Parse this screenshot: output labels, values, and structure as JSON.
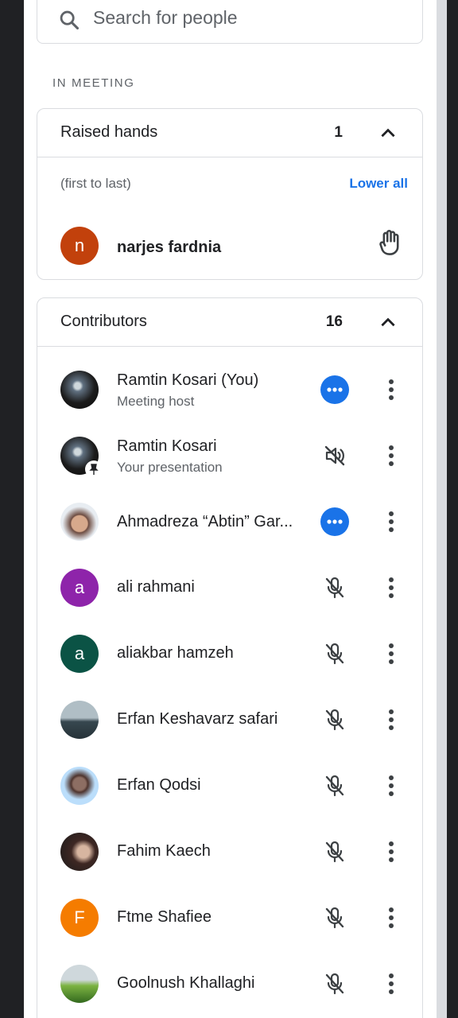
{
  "search": {
    "placeholder": "Search for people"
  },
  "in_meeting_label": "IN MEETING",
  "raised_hands": {
    "title": "Raised hands",
    "count": "1",
    "order_note": "(first to last)",
    "lower_all": "Lower all",
    "people": [
      {
        "name": "narjes fardnia",
        "initial": "n",
        "color": "#c2410c",
        "icon": "raised-hand-icon"
      }
    ]
  },
  "contributors": {
    "title": "Contributors",
    "count": "16",
    "people": [
      {
        "name": "Ramtin Kosari (You)",
        "subtitle": "Meeting host",
        "action": "audio-activity",
        "accent": "#1a73e8"
      },
      {
        "name": "Ramtin Kosari",
        "subtitle": "Your presentation",
        "action": "speaker-muted",
        "pinned": true
      },
      {
        "name": "Ahmadreza “Abtin” Gar...",
        "action": "audio-activity",
        "accent": "#1a73e8"
      },
      {
        "name": "ali rahmani",
        "initial": "a",
        "color": "#8e24aa",
        "action": "mic-off"
      },
      {
        "name": "aliakbar hamzeh",
        "initial": "a",
        "color": "#0b5345",
        "action": "mic-off"
      },
      {
        "name": "Erfan Keshavarz safari",
        "action": "mic-off"
      },
      {
        "name": "Erfan Qodsi",
        "action": "mic-off"
      },
      {
        "name": "Fahim Kaech",
        "action": "mic-off"
      },
      {
        "name": "Ftme Shafiee",
        "initial": "F",
        "color": "#f57c00",
        "action": "mic-off"
      },
      {
        "name": "Goolnush Khallaghi",
        "action": "mic-off"
      }
    ]
  }
}
